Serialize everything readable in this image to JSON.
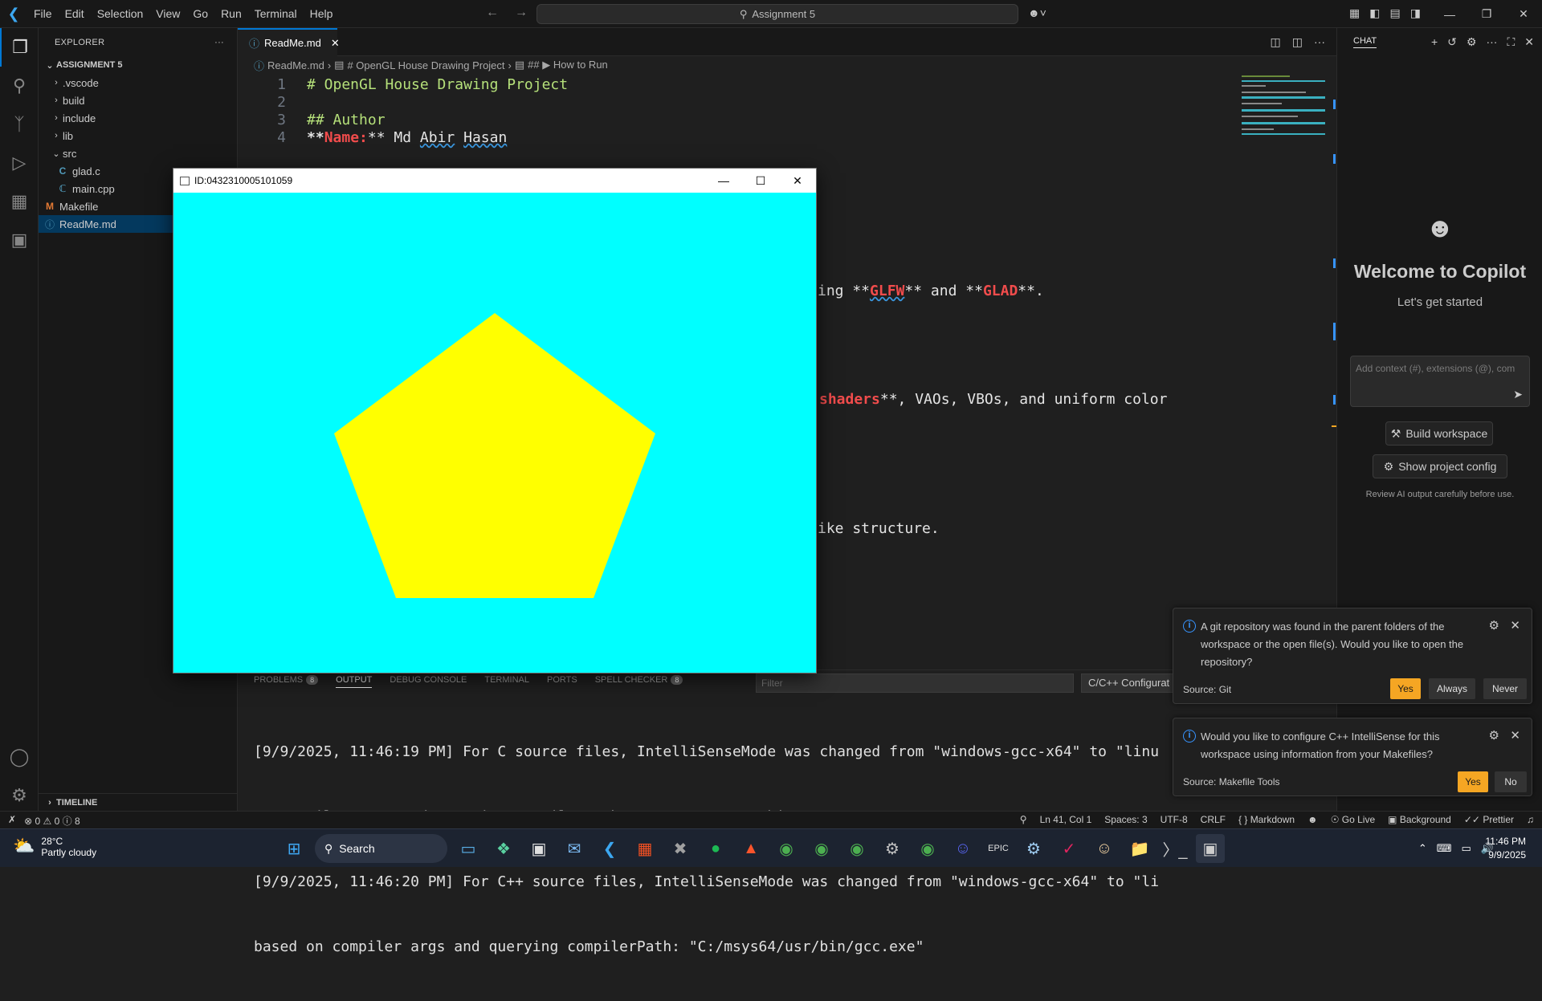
{
  "window": {
    "search_text": "Assignment 5"
  },
  "menu": [
    "File",
    "Edit",
    "Selection",
    "View",
    "Go",
    "Run",
    "Terminal",
    "Help"
  ],
  "explorer": {
    "header": "EXPLORER",
    "section": "ASSIGNMENT 5",
    "items": [
      {
        "label": ".vscode",
        "type": "folder",
        "depth": 1
      },
      {
        "label": "build",
        "type": "folder",
        "depth": 1
      },
      {
        "label": "include",
        "type": "folder",
        "depth": 1
      },
      {
        "label": "lib",
        "type": "folder",
        "depth": 1
      },
      {
        "label": "src",
        "type": "folder-open",
        "depth": 1
      },
      {
        "label": "glad.c",
        "type": "c-file",
        "depth": 2
      },
      {
        "label": "main.cpp",
        "type": "cpp-file",
        "depth": 2
      },
      {
        "label": "Makefile",
        "type": "makefile",
        "depth": 1
      },
      {
        "label": "ReadMe.md",
        "type": "md-file",
        "depth": 1
      }
    ],
    "timeline": "TIMELINE"
  },
  "editor": {
    "tab": "ReadMe.md",
    "breadcrumb": [
      "ReadMe.md",
      "# OpenGL House Drawing Project",
      "## ▶ How to Run"
    ],
    "line_numbers": [
      "1",
      "2",
      "3",
      "4"
    ],
    "lines": {
      "l1": "# OpenGL House Drawing Project",
      "l3": "## Author",
      "l4a": "**",
      "l4b": "Name:",
      "l4c": "** Md ",
      "l4d": "Abir",
      "l4e": " ",
      "l4f": "Hasan"
    },
    "visible_fragments": {
      "f1a": "ing **",
      "f1b": "GLFW",
      "f1c": "** and **",
      "f1d": "GLAD",
      "f1e": "**.",
      "f2a": "shaders",
      "f2b": "**, VAOs, VBOs, and uniform color",
      "f3": "ike structure."
    }
  },
  "panel": {
    "tabs": [
      {
        "label": "PROBLEMS",
        "badge": "8"
      },
      {
        "label": "OUTPUT",
        "badge": null
      },
      {
        "label": "DEBUG CONSOLE",
        "badge": null
      },
      {
        "label": "TERMINAL",
        "badge": null
      },
      {
        "label": "PORTS",
        "badge": null
      },
      {
        "label": "SPELL CHECKER",
        "badge": "8"
      }
    ],
    "filter_placeholder": "Filter",
    "channel": "C/C++ Configurat",
    "output": [
      "[9/9/2025, 11:46:19 PM] For C source files, IntelliSenseMode was changed from \"windows-gcc-x64\" to \"linu",
      "on compiler args and querying compilerPath: \"C:/msys64/usr/bin/gcc.exe\"",
      "[9/9/2025, 11:46:20 PM] For C++ source files, IntelliSenseMode was changed from \"windows-gcc-x64\" to \"li",
      "based on compiler args and querying compilerPath: \"C:/msys64/usr/bin/gcc.exe\""
    ]
  },
  "chat": {
    "tab": "CHAT",
    "welcome": "Welcome to Copilot",
    "subtitle": "Let's get started",
    "input_placeholder": "Add context (#), extensions (@), com",
    "build_button": "Build workspace",
    "config_button": "Show project config",
    "note": "Review AI output carefully before use."
  },
  "notifications": [
    {
      "message": "A git repository was found in the parent folders of the workspace or the open file(s). Would you like to open the repository?",
      "source": "Source: Git",
      "buttons": [
        "Yes",
        "Always",
        "Never"
      ]
    },
    {
      "message": "Would you like to configure C++ IntelliSense for this workspace using information from your Makefiles?",
      "source": "Source: Makefile Tools",
      "buttons": [
        "Yes",
        "No"
      ]
    }
  ],
  "glwindow": {
    "title": "ID:0432310005101059",
    "bg_color": "#00ffff",
    "shape_color": "#ffff00"
  },
  "statusbar": {
    "errors": "0",
    "warnings": "0",
    "infos": "8",
    "position": "Ln 41, Col 1",
    "spaces": "Spaces: 3",
    "encoding": "UTF-8",
    "eol": "CRLF",
    "language": "Markdown",
    "golive": "Go Live",
    "background": "Background",
    "prettier": "Prettier"
  },
  "taskbar": {
    "temp": "28°C",
    "weather": "Partly cloudy",
    "search": "Search",
    "time": "11:46 PM",
    "date": "9/9/2025"
  }
}
